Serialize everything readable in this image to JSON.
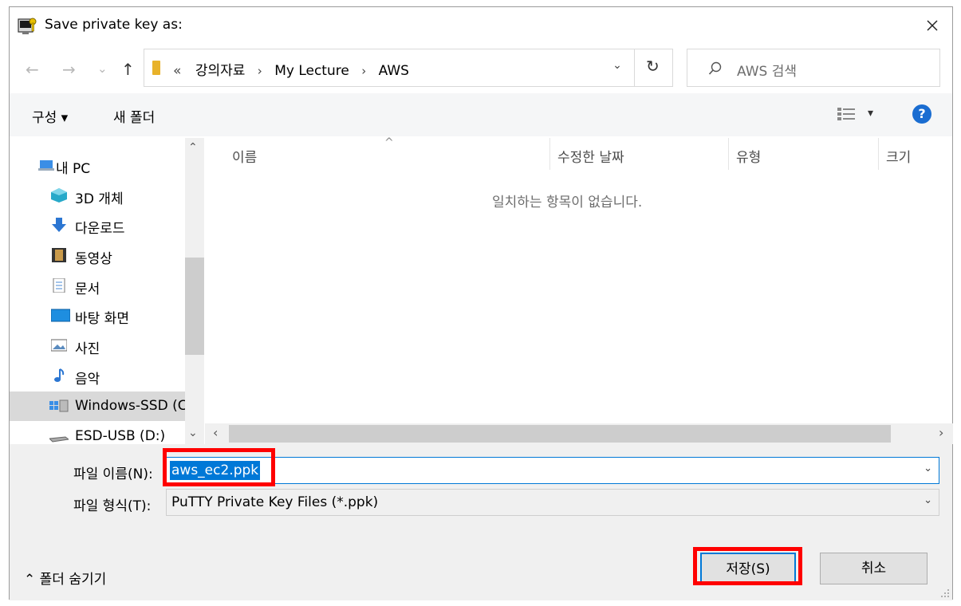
{
  "window": {
    "title": "Save private key as:"
  },
  "address": {
    "back_label": "←",
    "forward_label": "→",
    "recent_label": "⌄",
    "up_label": "↑",
    "overflow": "«",
    "crumbs": [
      "강의자료",
      "My Lecture",
      "AWS"
    ],
    "separator": "›",
    "dropdown": "⌄",
    "refresh": "↻"
  },
  "search": {
    "placeholder": "AWS 검색"
  },
  "commandbar": {
    "organize": "구성 ▾",
    "new_folder": "새 폴더",
    "view_dropdown": "▾",
    "help": "?"
  },
  "nav": {
    "items": [
      {
        "label": "내 PC",
        "icon": "pc-icon"
      },
      {
        "label": "3D 개체",
        "icon": "cube-icon"
      },
      {
        "label": "다운로드",
        "icon": "download-icon"
      },
      {
        "label": "동영상",
        "icon": "video-icon"
      },
      {
        "label": "문서",
        "icon": "document-icon"
      },
      {
        "label": "바탕 화면",
        "icon": "desktop-icon"
      },
      {
        "label": "사진",
        "icon": "picture-icon"
      },
      {
        "label": "음악",
        "icon": "music-icon"
      },
      {
        "label": "Windows-SSD (C",
        "icon": "drive-icon"
      },
      {
        "label": "ESD-USB (D:)",
        "icon": "usb-drive-icon"
      }
    ]
  },
  "filelist": {
    "columns": [
      "이름",
      "수정한 날짜",
      "유형",
      "크기"
    ],
    "empty_message": "일치하는 항목이 없습니다."
  },
  "footer": {
    "filename_label": "파일 이름(N):",
    "filename_value": "aws_ec2.ppk",
    "filetype_label": "파일 형식(T):",
    "filetype_value": "PuTTY Private Key Files (*.ppk)",
    "hide_folders": "⌃  폴더 숨기기",
    "save_button": "저장(S)",
    "cancel_button": "취소"
  },
  "colors": {
    "accent": "#0078d7",
    "highlight": "#ff0000"
  }
}
